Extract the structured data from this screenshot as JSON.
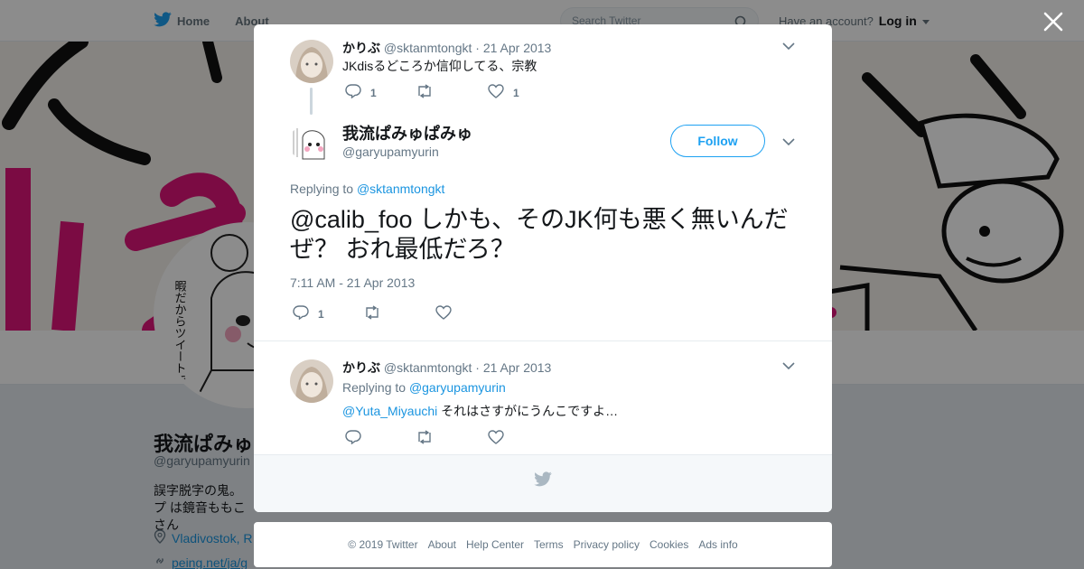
{
  "topbar": {
    "home_label": "Home",
    "about_label": "About",
    "search_placeholder": "Search Twitter",
    "have_account": "Have an account?",
    "login_label": "Log in"
  },
  "profile": {
    "name": "我流ぱみゅぱみゅ",
    "handle": "@garyupamyurin",
    "bio": "誤字脱字の鬼。プ は鏡音ももこさん",
    "location": "Vladivostok, R",
    "link": "peing.net/ja/g",
    "avatar_text": "暇だからツイートでもTLに不穏な流すか"
  },
  "modal": {
    "tweet1": {
      "name": "かりぶ",
      "handle": "@sktanmtongkt",
      "date": "21 Apr 2013",
      "text": "JKdisるどころか信仰してる、宗教",
      "reply_count": "1",
      "retweet_count": "",
      "like_count": "1"
    },
    "main": {
      "name": "我流ぱみゅぱみゅ",
      "handle": "@garyupamyurin",
      "follow_label": "Follow",
      "replying_prefix": "Replying to",
      "replying_to": "@sktanmtongkt",
      "text": "@calib_foo しかも、そのJK何も悪く無いんだぜ？ おれ最低だろ？",
      "timestamp": "7:11 AM - 21 Apr 2013",
      "reply_count": "1",
      "retweet_count": "",
      "like_count": ""
    },
    "reply": {
      "name": "かりぶ",
      "handle": "@sktanmtongkt",
      "date": "21 Apr 2013",
      "replying_prefix": "Replying to",
      "replying_to": "@garyupamyurin",
      "mention": "@Yuta_Miyauchi",
      "text": "それはさすがにうんこですよ…",
      "reply_count": "",
      "retweet_count": "",
      "like_count": ""
    }
  },
  "footer": {
    "copyright": "© 2019 Twitter",
    "links": [
      "About",
      "Help Center",
      "Terms",
      "Privacy policy",
      "Cookies",
      "Ads info"
    ]
  },
  "colors": {
    "accent": "#1da1f2",
    "link": "#1b95e0",
    "muted": "#657786"
  }
}
